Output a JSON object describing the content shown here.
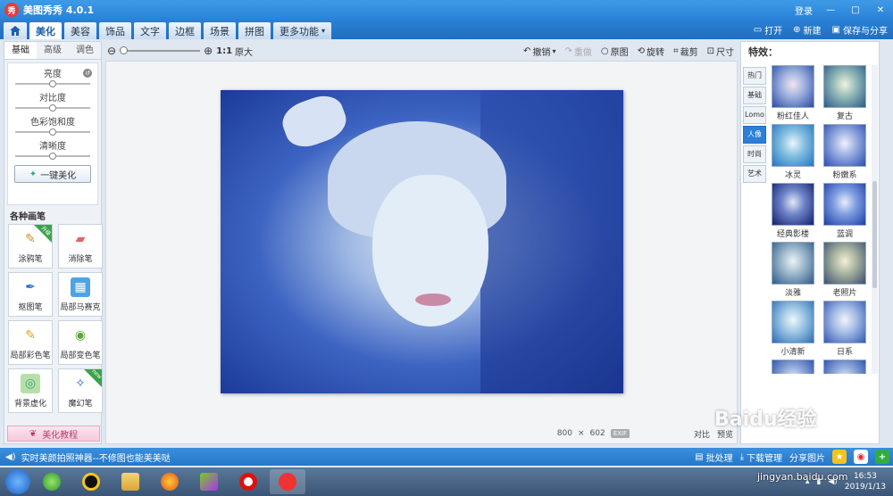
{
  "titlebar": {
    "title": "美图秀秀 4.0.1",
    "logo_text": "秀",
    "login": "登录",
    "min": "—",
    "max": "□",
    "close": "✕"
  },
  "menu": {
    "tabs": [
      "美化",
      "美容",
      "饰品",
      "文字",
      "边框",
      "场景",
      "拼图"
    ],
    "more": "更多功能",
    "open": "打开",
    "new": "新建",
    "save": "保存与分享"
  },
  "left": {
    "subtabs": [
      "基础",
      "高级",
      "调色"
    ],
    "sliders": [
      {
        "label": "亮度",
        "value": 0.5
      },
      {
        "label": "对比度",
        "value": 0.5
      },
      {
        "label": "色彩饱和度",
        "value": 0.5
      },
      {
        "label": "清晰度",
        "value": 0.5
      }
    ],
    "one_click": "一键美化",
    "brush_title": "各种画笔",
    "brushes": [
      {
        "label": "涂鸦笔",
        "badge": "升级"
      },
      {
        "label": "消除笔",
        "badge": ""
      },
      {
        "label": "抠图笔",
        "badge": ""
      },
      {
        "label": "局部马赛克",
        "badge": ""
      },
      {
        "label": "局部彩色笔",
        "badge": ""
      },
      {
        "label": "局部变色笔",
        "badge": ""
      },
      {
        "label": "背景虚化",
        "badge": ""
      },
      {
        "label": "魔幻笔",
        "badge": "new"
      }
    ],
    "tutorial": "美化教程"
  },
  "toolbar": {
    "ratio": "1:1",
    "orig": "原大",
    "undo": "撤销",
    "redo": "重做",
    "original": "原图",
    "rotate": "旋转",
    "crop": "裁剪",
    "resize": "尺寸"
  },
  "canvas": {
    "width": "800",
    "times": "×",
    "height": "602",
    "exif": "EXIF",
    "compare": "对比",
    "preview": "预览"
  },
  "right": {
    "title": "特效：",
    "categories": [
      "热门",
      "基础",
      "Lomo",
      "人像",
      "时尚",
      "艺术"
    ],
    "active_category": 3,
    "effects": [
      "粉红佳人",
      "复古",
      "冰灵",
      "粉嫩系",
      "经典影楼",
      "蓝调",
      "淡雅",
      "老照片",
      "小清新",
      "日系",
      "",
      ""
    ]
  },
  "status": {
    "text": "实时美颜拍照神器--不修图也能美美哒",
    "batch": "批处理",
    "download": "下载管理",
    "share": "分享图片"
  },
  "taskbar": {
    "time": "16:53",
    "date": "2019/1/13"
  },
  "watermark": {
    "brand": "Baidu经验",
    "url": "jingyan.baidu.com"
  },
  "colors": {
    "accent": "#2a82d8",
    "active_category": "#2c7fd6"
  }
}
